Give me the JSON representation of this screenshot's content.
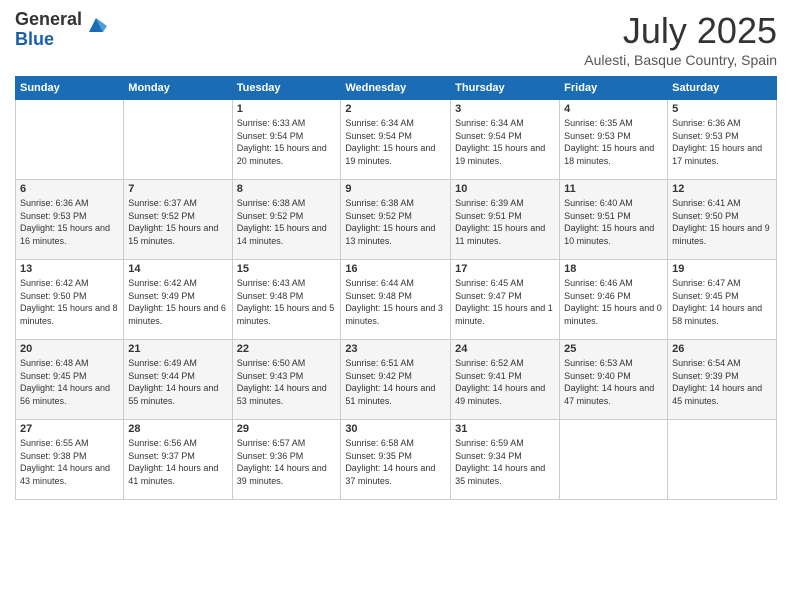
{
  "logo": {
    "general": "General",
    "blue": "Blue"
  },
  "title": "July 2025",
  "location": "Aulesti, Basque Country, Spain",
  "weekdays": [
    "Sunday",
    "Monday",
    "Tuesday",
    "Wednesday",
    "Thursday",
    "Friday",
    "Saturday"
  ],
  "weeks": [
    [
      {
        "day": "",
        "sunrise": "",
        "sunset": "",
        "daylight": ""
      },
      {
        "day": "",
        "sunrise": "",
        "sunset": "",
        "daylight": ""
      },
      {
        "day": "1",
        "sunrise": "Sunrise: 6:33 AM",
        "sunset": "Sunset: 9:54 PM",
        "daylight": "Daylight: 15 hours and 20 minutes."
      },
      {
        "day": "2",
        "sunrise": "Sunrise: 6:34 AM",
        "sunset": "Sunset: 9:54 PM",
        "daylight": "Daylight: 15 hours and 19 minutes."
      },
      {
        "day": "3",
        "sunrise": "Sunrise: 6:34 AM",
        "sunset": "Sunset: 9:54 PM",
        "daylight": "Daylight: 15 hours and 19 minutes."
      },
      {
        "day": "4",
        "sunrise": "Sunrise: 6:35 AM",
        "sunset": "Sunset: 9:53 PM",
        "daylight": "Daylight: 15 hours and 18 minutes."
      },
      {
        "day": "5",
        "sunrise": "Sunrise: 6:36 AM",
        "sunset": "Sunset: 9:53 PM",
        "daylight": "Daylight: 15 hours and 17 minutes."
      }
    ],
    [
      {
        "day": "6",
        "sunrise": "Sunrise: 6:36 AM",
        "sunset": "Sunset: 9:53 PM",
        "daylight": "Daylight: 15 hours and 16 minutes."
      },
      {
        "day": "7",
        "sunrise": "Sunrise: 6:37 AM",
        "sunset": "Sunset: 9:52 PM",
        "daylight": "Daylight: 15 hours and 15 minutes."
      },
      {
        "day": "8",
        "sunrise": "Sunrise: 6:38 AM",
        "sunset": "Sunset: 9:52 PM",
        "daylight": "Daylight: 15 hours and 14 minutes."
      },
      {
        "day": "9",
        "sunrise": "Sunrise: 6:38 AM",
        "sunset": "Sunset: 9:52 PM",
        "daylight": "Daylight: 15 hours and 13 minutes."
      },
      {
        "day": "10",
        "sunrise": "Sunrise: 6:39 AM",
        "sunset": "Sunset: 9:51 PM",
        "daylight": "Daylight: 15 hours and 11 minutes."
      },
      {
        "day": "11",
        "sunrise": "Sunrise: 6:40 AM",
        "sunset": "Sunset: 9:51 PM",
        "daylight": "Daylight: 15 hours and 10 minutes."
      },
      {
        "day": "12",
        "sunrise": "Sunrise: 6:41 AM",
        "sunset": "Sunset: 9:50 PM",
        "daylight": "Daylight: 15 hours and 9 minutes."
      }
    ],
    [
      {
        "day": "13",
        "sunrise": "Sunrise: 6:42 AM",
        "sunset": "Sunset: 9:50 PM",
        "daylight": "Daylight: 15 hours and 8 minutes."
      },
      {
        "day": "14",
        "sunrise": "Sunrise: 6:42 AM",
        "sunset": "Sunset: 9:49 PM",
        "daylight": "Daylight: 15 hours and 6 minutes."
      },
      {
        "day": "15",
        "sunrise": "Sunrise: 6:43 AM",
        "sunset": "Sunset: 9:48 PM",
        "daylight": "Daylight: 15 hours and 5 minutes."
      },
      {
        "day": "16",
        "sunrise": "Sunrise: 6:44 AM",
        "sunset": "Sunset: 9:48 PM",
        "daylight": "Daylight: 15 hours and 3 minutes."
      },
      {
        "day": "17",
        "sunrise": "Sunrise: 6:45 AM",
        "sunset": "Sunset: 9:47 PM",
        "daylight": "Daylight: 15 hours and 1 minute."
      },
      {
        "day": "18",
        "sunrise": "Sunrise: 6:46 AM",
        "sunset": "Sunset: 9:46 PM",
        "daylight": "Daylight: 15 hours and 0 minutes."
      },
      {
        "day": "19",
        "sunrise": "Sunrise: 6:47 AM",
        "sunset": "Sunset: 9:45 PM",
        "daylight": "Daylight: 14 hours and 58 minutes."
      }
    ],
    [
      {
        "day": "20",
        "sunrise": "Sunrise: 6:48 AM",
        "sunset": "Sunset: 9:45 PM",
        "daylight": "Daylight: 14 hours and 56 minutes."
      },
      {
        "day": "21",
        "sunrise": "Sunrise: 6:49 AM",
        "sunset": "Sunset: 9:44 PM",
        "daylight": "Daylight: 14 hours and 55 minutes."
      },
      {
        "day": "22",
        "sunrise": "Sunrise: 6:50 AM",
        "sunset": "Sunset: 9:43 PM",
        "daylight": "Daylight: 14 hours and 53 minutes."
      },
      {
        "day": "23",
        "sunrise": "Sunrise: 6:51 AM",
        "sunset": "Sunset: 9:42 PM",
        "daylight": "Daylight: 14 hours and 51 minutes."
      },
      {
        "day": "24",
        "sunrise": "Sunrise: 6:52 AM",
        "sunset": "Sunset: 9:41 PM",
        "daylight": "Daylight: 14 hours and 49 minutes."
      },
      {
        "day": "25",
        "sunrise": "Sunrise: 6:53 AM",
        "sunset": "Sunset: 9:40 PM",
        "daylight": "Daylight: 14 hours and 47 minutes."
      },
      {
        "day": "26",
        "sunrise": "Sunrise: 6:54 AM",
        "sunset": "Sunset: 9:39 PM",
        "daylight": "Daylight: 14 hours and 45 minutes."
      }
    ],
    [
      {
        "day": "27",
        "sunrise": "Sunrise: 6:55 AM",
        "sunset": "Sunset: 9:38 PM",
        "daylight": "Daylight: 14 hours and 43 minutes."
      },
      {
        "day": "28",
        "sunrise": "Sunrise: 6:56 AM",
        "sunset": "Sunset: 9:37 PM",
        "daylight": "Daylight: 14 hours and 41 minutes."
      },
      {
        "day": "29",
        "sunrise": "Sunrise: 6:57 AM",
        "sunset": "Sunset: 9:36 PM",
        "daylight": "Daylight: 14 hours and 39 minutes."
      },
      {
        "day": "30",
        "sunrise": "Sunrise: 6:58 AM",
        "sunset": "Sunset: 9:35 PM",
        "daylight": "Daylight: 14 hours and 37 minutes."
      },
      {
        "day": "31",
        "sunrise": "Sunrise: 6:59 AM",
        "sunset": "Sunset: 9:34 PM",
        "daylight": "Daylight: 14 hours and 35 minutes."
      },
      {
        "day": "",
        "sunrise": "",
        "sunset": "",
        "daylight": ""
      },
      {
        "day": "",
        "sunrise": "",
        "sunset": "",
        "daylight": ""
      }
    ]
  ]
}
